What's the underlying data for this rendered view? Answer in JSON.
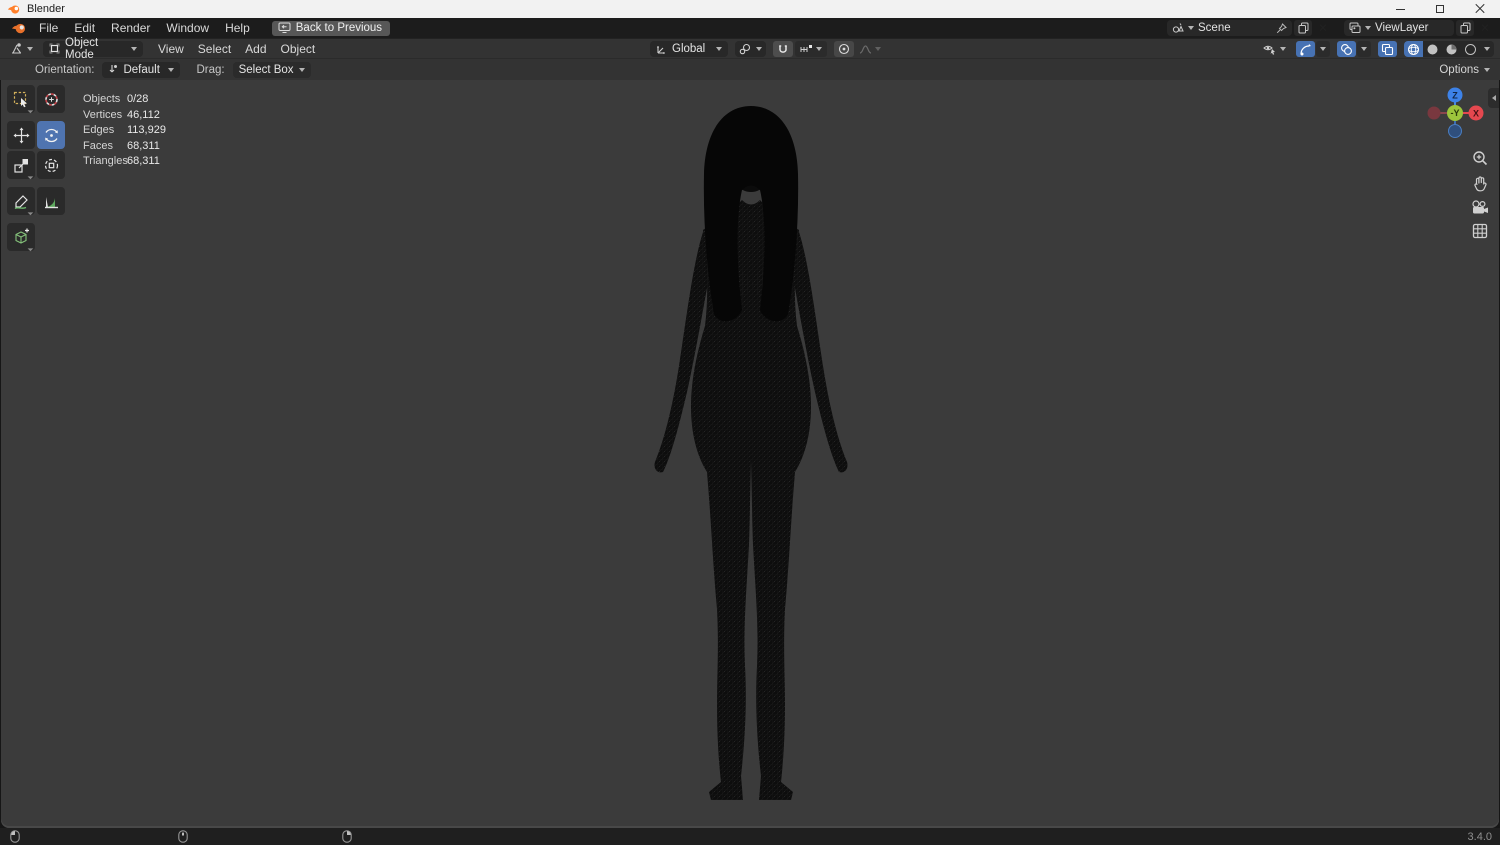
{
  "titlebar": {
    "app_title": "Blender"
  },
  "menubar": {
    "items": [
      "File",
      "Edit",
      "Render",
      "Window",
      "Help"
    ],
    "back_button_label": "Back to Previous"
  },
  "scene_bar": {
    "scene_value": "Scene",
    "viewlayer_value": "ViewLayer"
  },
  "tool_header": {
    "mode_value": "Object Mode",
    "menus": [
      "View",
      "Select",
      "Add",
      "Object"
    ],
    "orientation_value": "Global"
  },
  "tool_settings": {
    "orientation_label": "Orientation:",
    "orientation_value": "Default",
    "drag_label": "Drag:",
    "drag_value": "Select Box",
    "options_label": "Options"
  },
  "viewport": {
    "stats": {
      "rows": [
        {
          "label": "Objects",
          "value": "0/28"
        },
        {
          "label": "Vertices",
          "value": "46,112"
        },
        {
          "label": "Edges",
          "value": "113,929"
        },
        {
          "label": "Faces",
          "value": "68,311"
        },
        {
          "label": "Triangles",
          "value": "68,311"
        }
      ]
    },
    "gizmo_axes": {
      "z": "Z",
      "x": "X",
      "y_front": "-Y"
    }
  },
  "statusbar": {
    "version": "3.4.0"
  },
  "colors": {
    "accent_blue": "#4772b3",
    "axis_x_red": "#e5484f",
    "axis_z_blue": "#3d82e8",
    "axis_y_green": "#9cc43c",
    "viewport_bg": "#3b3b3b"
  }
}
